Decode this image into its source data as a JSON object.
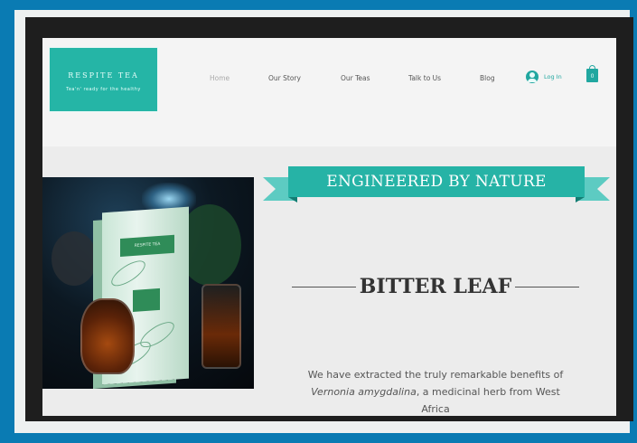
{
  "brand": {
    "name": "RESPITE TEA",
    "tagline": "Tea'n' ready for the healthy"
  },
  "nav": {
    "items": [
      {
        "label": "Home",
        "active": true
      },
      {
        "label": "Our Story",
        "active": false
      },
      {
        "label": "Our Teas",
        "active": false
      },
      {
        "label": "Talk to Us",
        "active": false
      },
      {
        "label": "Blog",
        "active": false
      }
    ],
    "login_label": "Log In",
    "cart_count": "0"
  },
  "hero": {
    "ribbon": "ENGINEERED BY NATURE",
    "heading": "BITTER LEAF",
    "box_label": "RESPITE TEA",
    "blurb_prefix": "We have extracted the truly remarkable benefits of ",
    "blurb_italic": "Vernonia amygdalina",
    "blurb_suffix": ", a medicinal herb from West Africa"
  },
  "colors": {
    "accent": "#26b3a6",
    "outer_background": "#0a7bb3",
    "frame": "#1e1e1e"
  }
}
